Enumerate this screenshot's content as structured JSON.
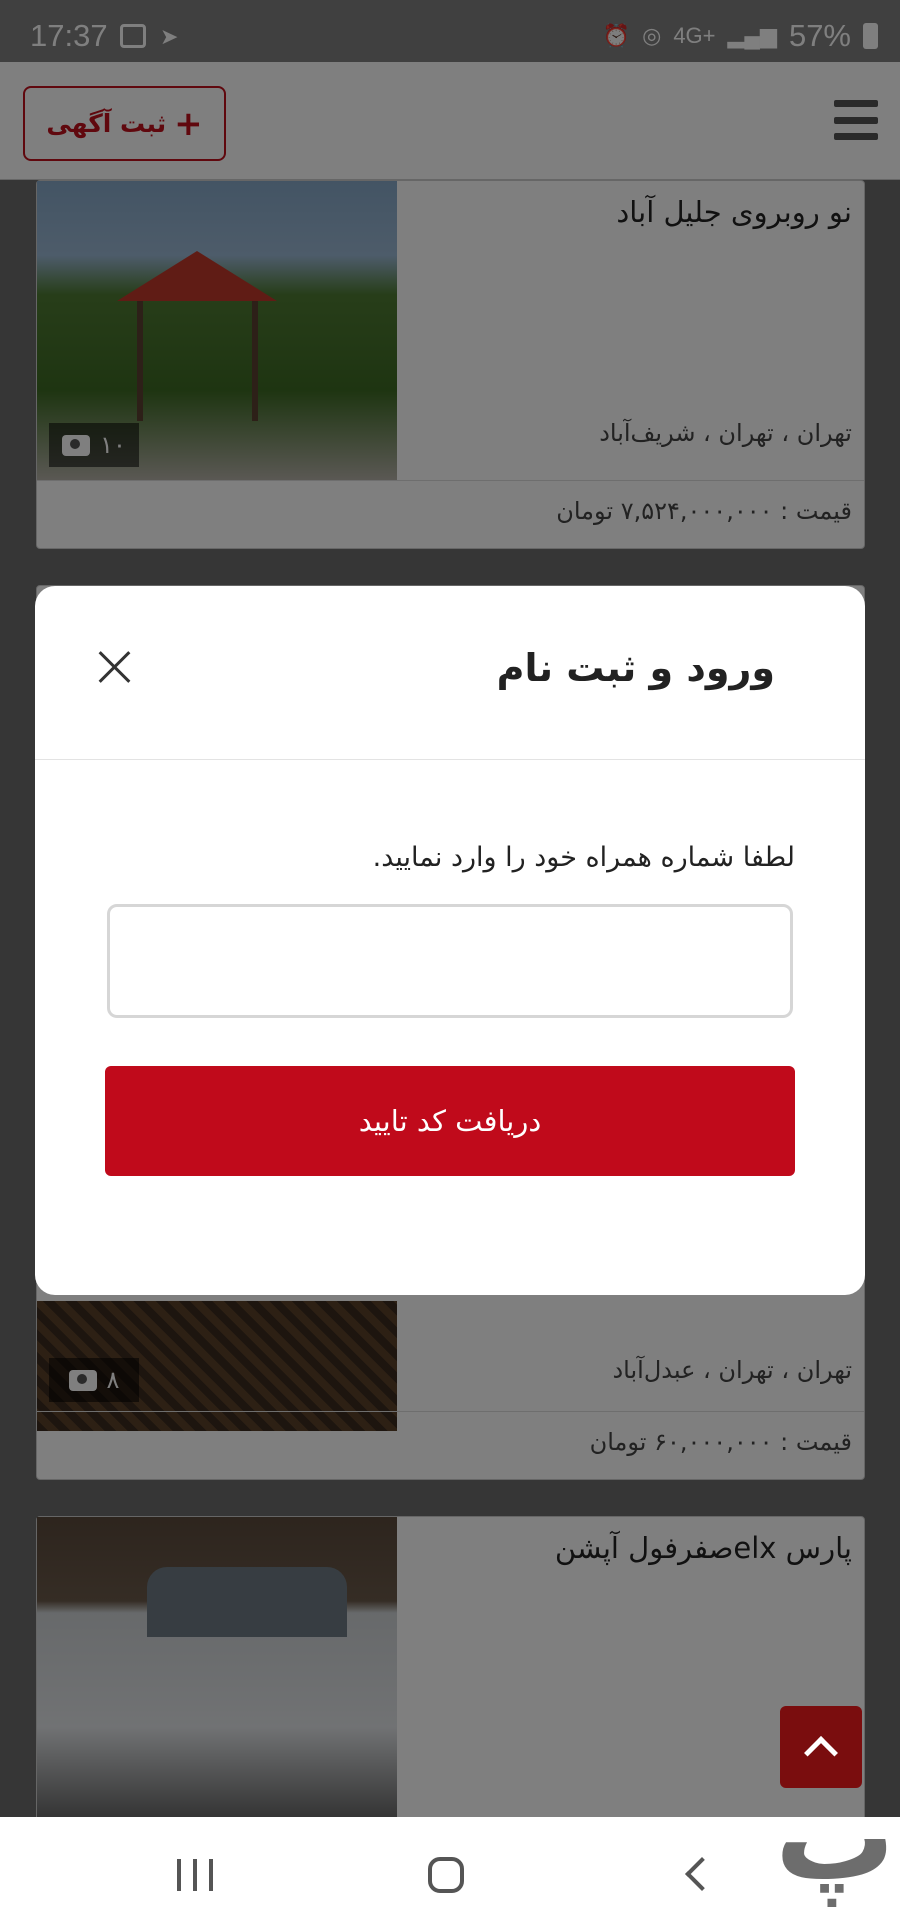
{
  "status_bar": {
    "time": "17:37",
    "battery": "57%",
    "network": "4G+"
  },
  "header": {
    "post_ad_label": "ثبت آگهی",
    "post_ad_plus": "+"
  },
  "listings": [
    {
      "title": "نو روبروی جلیل آباد",
      "location": "تهران ، تهران ، شریف‌آباد",
      "price": "قیمت : ۷,۵۲۴,۰۰۰,۰۰۰ تومان",
      "photo_count": "۱۰"
    },
    {
      "title": "",
      "location": "تهران ، تهران ، عبدل‌آباد",
      "price": "قیمت : ۶۰,۰۰۰,۰۰۰ تومان",
      "photo_count": "۸"
    },
    {
      "title": "پارس elxصفرفول آپشن",
      "location": "",
      "price": "",
      "photo_count": ""
    }
  ],
  "modal": {
    "title": "ورود و ثبت نام",
    "hint": "لطفا شماره همراه خود را وارد نمایید.",
    "phone_value": "",
    "phone_placeholder": "",
    "submit_label": "دریافت کد تایید"
  },
  "icons": {
    "close": "close-icon",
    "menu": "hamburger-menu-icon",
    "camera": "camera-icon",
    "scroll_top": "chevron-up-icon"
  },
  "colors": {
    "brand_red": "#c00a1b",
    "header_bg": "#ffffff",
    "overlay": "rgba(0,0,0,0.5)"
  }
}
